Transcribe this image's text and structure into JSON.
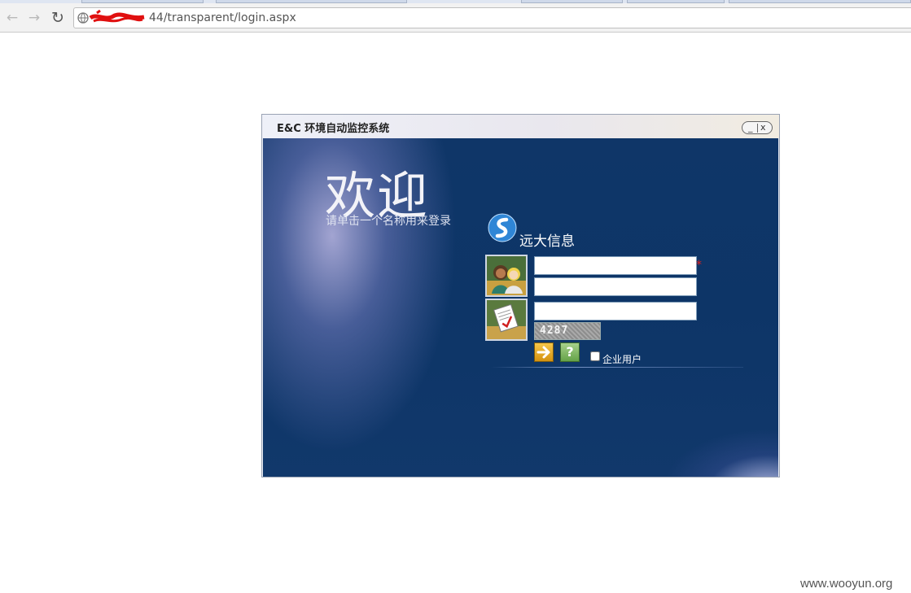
{
  "browser": {
    "url": "44/transparent/login.aspx",
    "back_icon": "back-arrow-icon",
    "forward_icon": "forward-arrow-icon",
    "reload_icon": "reload-icon"
  },
  "window": {
    "title": "E&C 环境自动监控系统",
    "minimize_label": "_",
    "close_label": "x"
  },
  "login": {
    "welcome": "欢迎",
    "subtitle": "请单击一个名称用来登录",
    "brand_name": "远大信息",
    "username_value": "",
    "password_value": "",
    "captcha_input_value": "",
    "required_mark": "*",
    "captcha_code": "4287",
    "help_label": "?",
    "enterprise_label": "企业用户",
    "enterprise_checked": false
  },
  "colors": {
    "panel_bg": "#0d3567",
    "required": "#e02020"
  },
  "watermark": "www.wooyun.org"
}
